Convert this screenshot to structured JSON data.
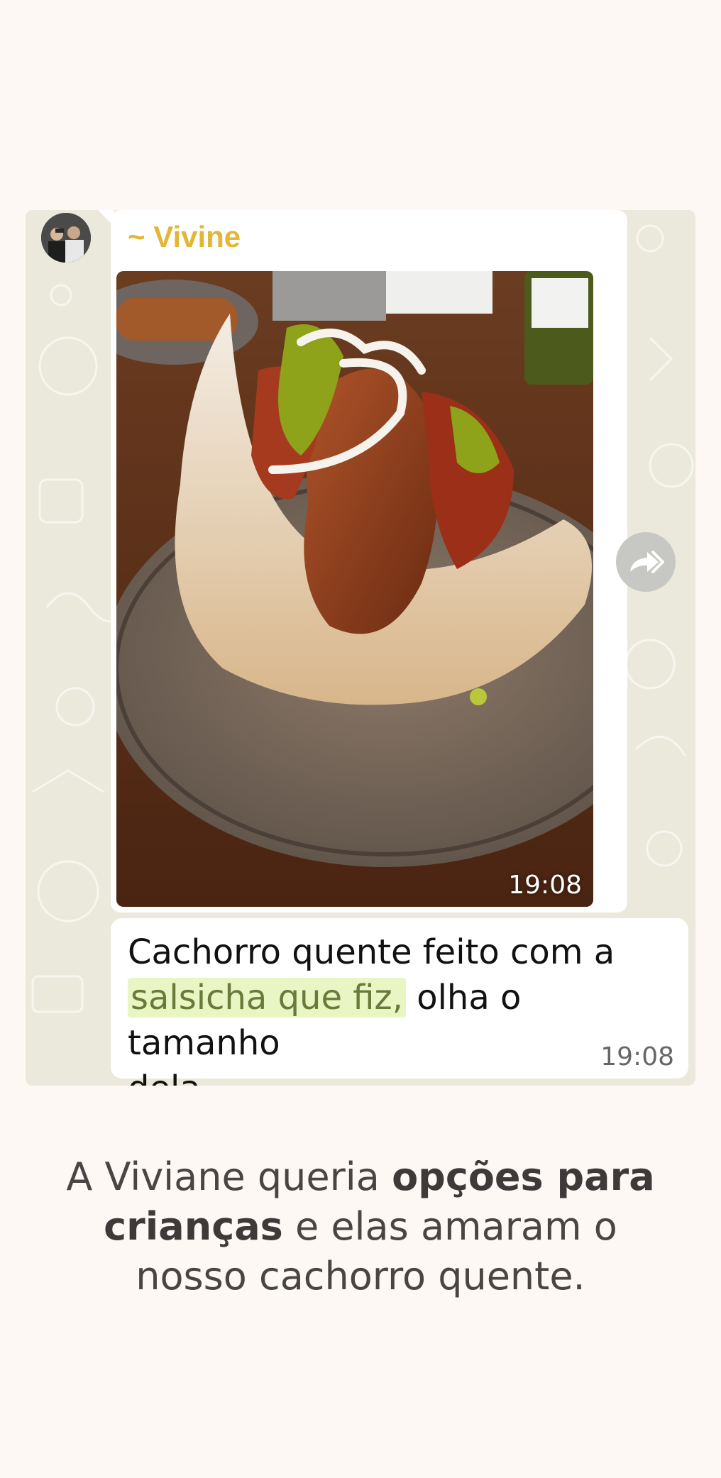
{
  "chat": {
    "sender": "~ Vivine",
    "photo_time": "19:08",
    "message": {
      "line1": "Cachorro quente feito com a",
      "highlight": "salsicha que fiz,",
      "line2_rest": " olha o tamanho",
      "line3": "dela."
    },
    "message_time": "19:08"
  },
  "caption": {
    "part1": "A Viviane queria ",
    "bold1": "opções para",
    "bold2": "crianças",
    "part2": " e elas amaram o",
    "part3": "nosso cachorro quente."
  },
  "colors": {
    "page_bg": "#fdf8f4",
    "chat_bg": "#ebe9dc",
    "sender_name": "#e2b735",
    "highlight_bg": "#eaf5c4"
  },
  "icons": {
    "forward": "forward-icon",
    "avatar": "avatar"
  }
}
